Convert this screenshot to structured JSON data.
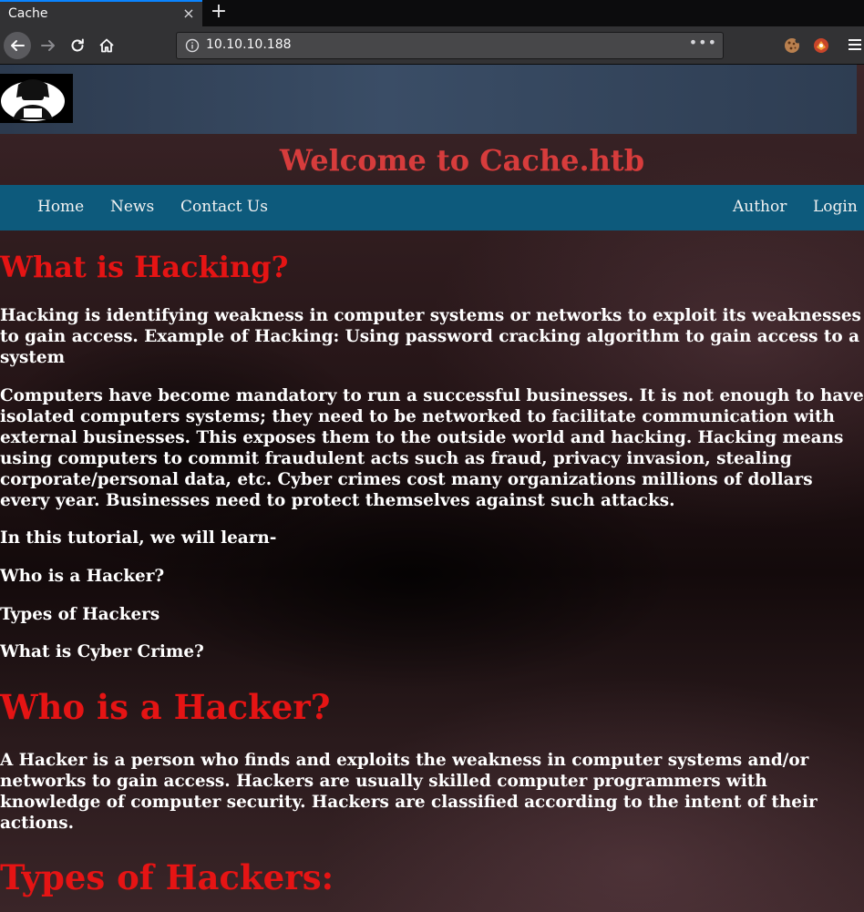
{
  "browser": {
    "tab_title": "Cache",
    "tab_close": "×",
    "new_tab": "+",
    "url": "10.10.10.188",
    "url_more": "•••"
  },
  "site": {
    "title": "Welcome to Cache.htb",
    "nav_left": [
      "Home",
      "News",
      "Contact Us"
    ],
    "nav_right": [
      "Author",
      "Login"
    ]
  },
  "content": {
    "h_hacking": "What is Hacking?",
    "p_hacking_1": "Hacking is identifying weakness in computer systems or networks to exploit its weaknesses to gain access. Example of Hacking: Using password cracking algorithm to gain access to a system",
    "p_hacking_2": "Computers have become mandatory to run a successful businesses. It is not enough to have isolated computers systems; they need to be networked to facilitate communication with external businesses. This exposes them to the outside world and hacking. Hacking means using computers to commit fraudulent acts such as fraud, privacy invasion, stealing corporate/personal data, etc. Cyber crimes cost many organizations millions of dollars every year. Businesses need to protect themselves against such attacks.",
    "p_learn": "In this tutorial, we will learn-",
    "toc": [
      "Who is a Hacker?",
      "Types of Hackers",
      "What is Cyber Crime?"
    ],
    "h_hacker": "Who is a Hacker?",
    "p_hacker": "A Hacker is a person who finds and exploits the weakness in computer systems and/or networks to gain access. Hackers are usually skilled computer programmers with knowledge of computer security. Hackers are classified according to the intent of their actions.",
    "h_types": "Types of Hackers:"
  }
}
